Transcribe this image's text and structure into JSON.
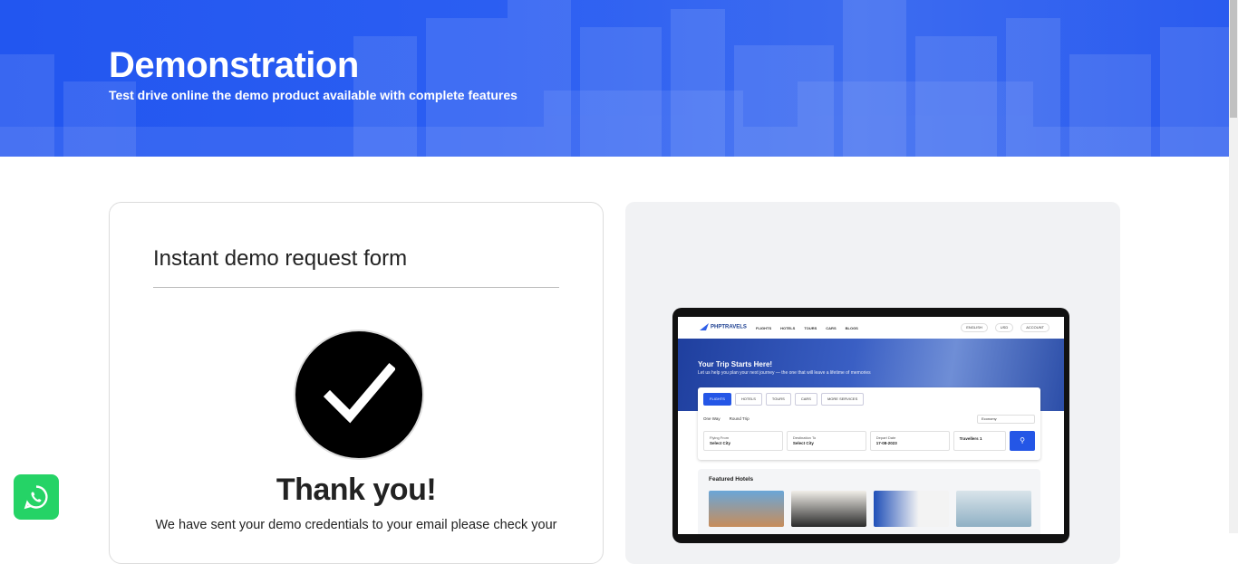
{
  "hero": {
    "title": "Demonstration",
    "subtitle": "Test drive online the demo product available with complete features"
  },
  "form": {
    "title": "Instant demo request form",
    "thanks": "Thank you!",
    "message": "We have sent your demo credentials to your email please check your"
  },
  "preview": {
    "logo": "PHPTRAVELS",
    "menu": [
      "FLIGHTS",
      "HOTELS",
      "TOURS",
      "CARS",
      "BLOGS"
    ],
    "right_pills": [
      "ENGLISH",
      "USD",
      "ACCOUNT"
    ],
    "hero_title": "Your Trip Starts Here!",
    "hero_subtitle": "Let us help you plan your next journey — the one that will leave a lifetime of memories",
    "tabs": [
      "FLIGHTS",
      "HOTELS",
      "TOURS",
      "CARS",
      "MORE SERVICES"
    ],
    "trip_types": [
      "One Way",
      "Round Trip"
    ],
    "cabin_class": "Economy",
    "fields": [
      {
        "label": "Flying From",
        "value": "Select City"
      },
      {
        "label": "Destination To",
        "value": "Select City"
      },
      {
        "label": "Depart Date",
        "value": "17-08-2023"
      },
      {
        "label": "",
        "value": "Travellers 1"
      }
    ],
    "search_icon": "search-icon",
    "featured_title": "Featured Hotels"
  },
  "colors": {
    "hero_blue": "#2256f0",
    "accent": "#2456e6",
    "whatsapp": "#25d366"
  },
  "floating": {
    "whatsapp_icon": "whatsapp-icon"
  }
}
